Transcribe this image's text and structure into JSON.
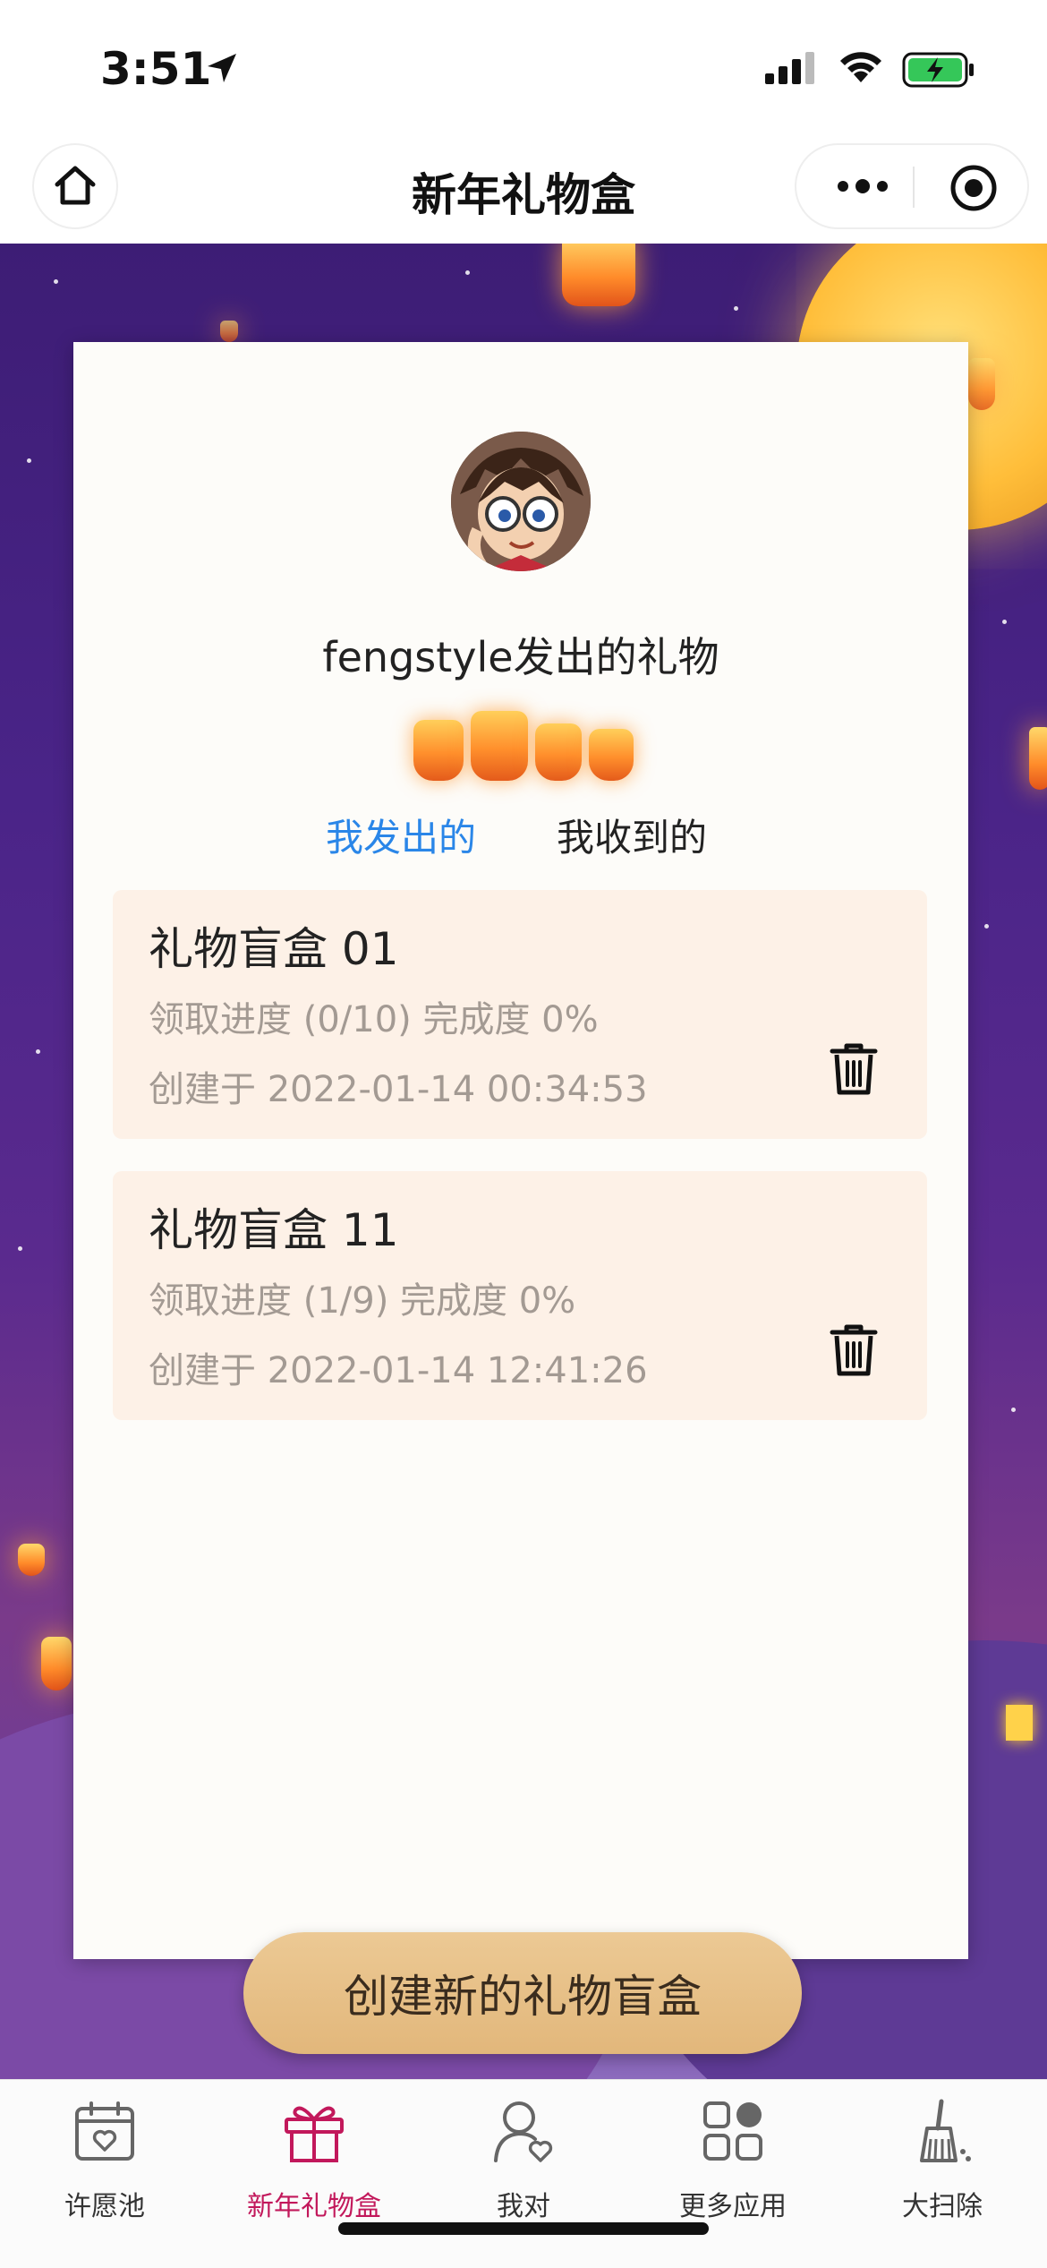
{
  "status_bar": {
    "time": "3:51"
  },
  "nav": {
    "title": "新年礼物盒"
  },
  "profile": {
    "owner_text": "fengstyle发出的礼物"
  },
  "tabs": [
    {
      "label": "我发出的",
      "active": true
    },
    {
      "label": "我收到的",
      "active": false
    }
  ],
  "gifts": [
    {
      "title": "礼物盲盒 01",
      "progress": "领取进度 (0/10) 完成度 0%",
      "created": "创建于 2022-01-14 00:34:53"
    },
    {
      "title": "礼物盲盒 11",
      "progress": "领取进度 (1/9) 完成度 0%",
      "created": "创建于 2022-01-14 12:41:26"
    }
  ],
  "create_button": {
    "label": "创建新的礼物盲盒"
  },
  "tabbar": {
    "items": [
      {
        "label": "许愿池",
        "icon": "calendar-heart-icon",
        "active": false
      },
      {
        "label": "新年礼物盒",
        "icon": "gift-icon",
        "active": true
      },
      {
        "label": "我对",
        "icon": "person-heart-icon",
        "active": false
      },
      {
        "label": "更多应用",
        "icon": "apps-grid-icon",
        "active": false
      },
      {
        "label": "大扫除",
        "icon": "broom-icon",
        "active": false
      }
    ]
  },
  "colors": {
    "active_tab": "#2a86e8",
    "tabbar_active": "#c2185b",
    "button_bg": "#e2b77b",
    "gift_bg": "#fdf1e7"
  }
}
